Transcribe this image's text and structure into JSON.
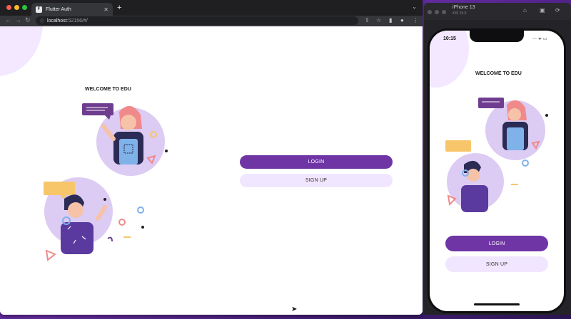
{
  "browser": {
    "tab_title": "Flutter Auth",
    "tab_favicon": "F",
    "url_host": "localhost",
    "url_rest": ":52156/#/",
    "icons": [
      "back-icon",
      "forward-icon",
      "reload-icon",
      "lock-icon",
      "share-icon",
      "star-icon",
      "sidepanel-icon",
      "profile-icon",
      "menu-icon"
    ]
  },
  "app": {
    "welcome": "WELCOME TO EDU",
    "login_label": "LOGIN",
    "signup_label": "SIGN UP",
    "colors": {
      "primary": "#6f35a5",
      "primary_light": "#f1e6ff"
    }
  },
  "simulator": {
    "device": "iPhone 13",
    "os": "iOS 15.0",
    "time": "10:15"
  }
}
